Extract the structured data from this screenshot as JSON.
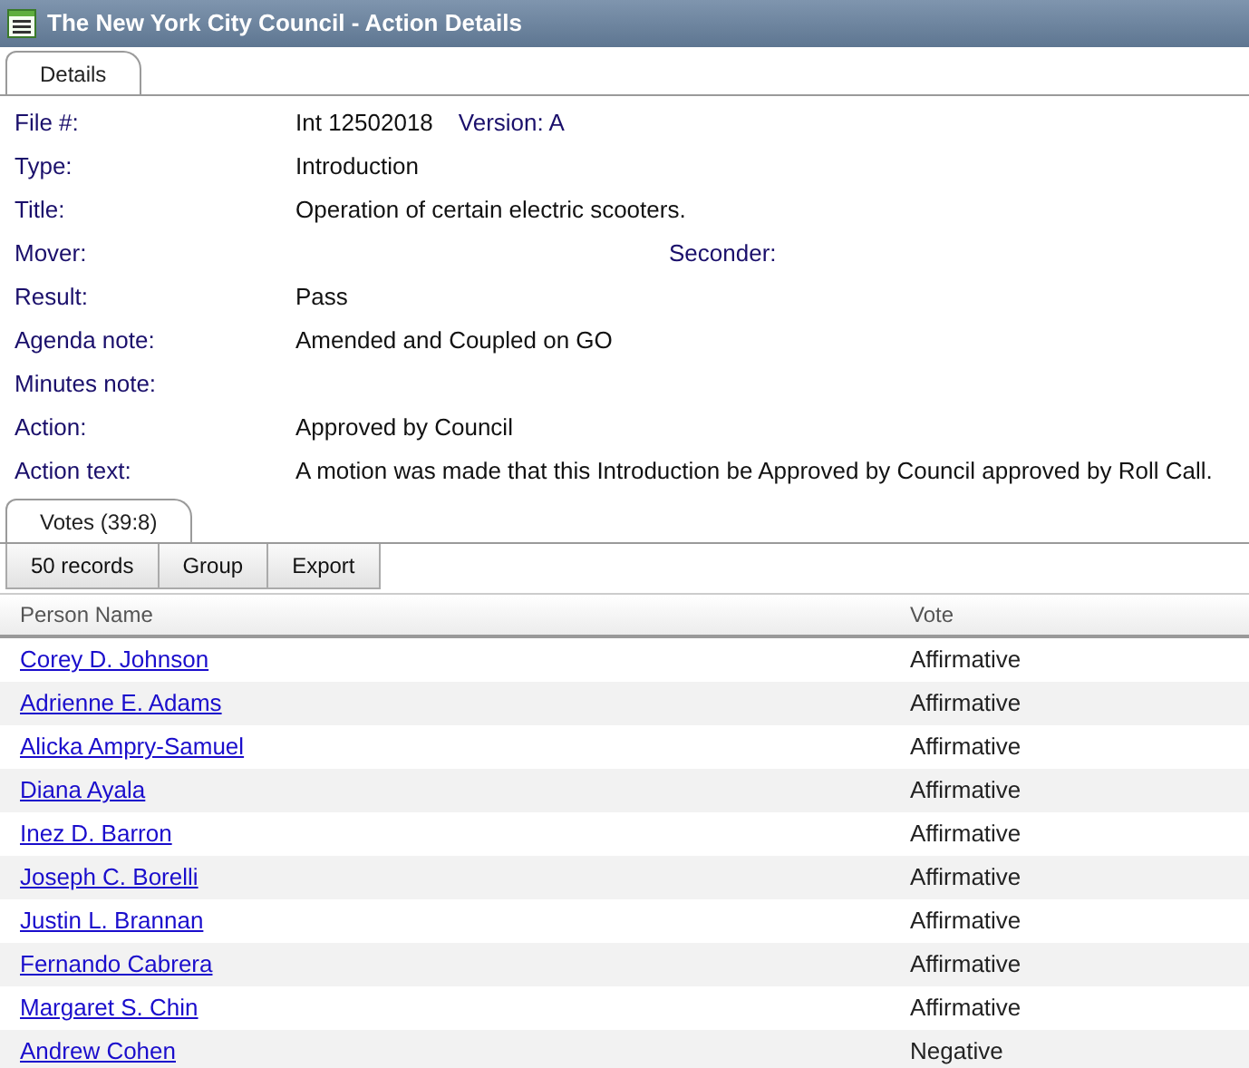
{
  "window": {
    "title": "The New York City Council - Action Details"
  },
  "details_tab": {
    "label": "Details",
    "selected": true
  },
  "fields": [
    {
      "label": "File #:",
      "value": "Int 12502018",
      "version": "Version: A"
    },
    {
      "label": "Type:",
      "value": "Introduction"
    },
    {
      "label": "Title:",
      "value": "Operation of certain electric scooters."
    },
    {
      "label": "Mover:",
      "seconder_label": "Seconder:"
    },
    {
      "label": "Result:",
      "value": "Pass"
    },
    {
      "label": "Agenda note:",
      "value": "Amended and Coupled on GO"
    },
    {
      "label": "Minutes note:"
    },
    {
      "label": "Action:",
      "value": "Approved by Council"
    },
    {
      "label": "Action text:",
      "value": "A motion was made that this Introduction be Approved by Council approved by Roll Call."
    }
  ],
  "votes_tab": {
    "label": "Votes (39:8)",
    "selected": true
  },
  "toolbar": [
    "50 records",
    "Group",
    "Export"
  ],
  "table": {
    "columns": [
      "Person Name",
      "Vote"
    ],
    "rows": [
      {
        "name": "Corey D. Johnson",
        "vote": "Affirmative"
      },
      {
        "name": "Adrienne E. Adams",
        "vote": "Affirmative"
      },
      {
        "name": "Alicka Ampry-Samuel",
        "vote": "Affirmative"
      },
      {
        "name": "Diana Ayala",
        "vote": "Affirmative"
      },
      {
        "name": "Inez D. Barron",
        "vote": "Affirmative"
      },
      {
        "name": "Joseph C. Borelli",
        "vote": "Affirmative"
      },
      {
        "name": "Justin L. Brannan",
        "vote": "Affirmative"
      },
      {
        "name": "Fernando Cabrera",
        "vote": "Affirmative"
      },
      {
        "name": "Margaret S. Chin",
        "vote": "Affirmative"
      },
      {
        "name": "Andrew Cohen",
        "vote": "Negative"
      }
    ]
  }
}
